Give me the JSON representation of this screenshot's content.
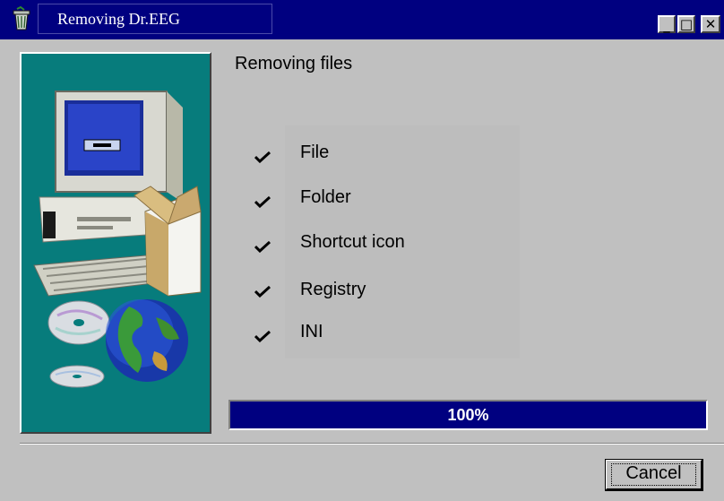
{
  "window": {
    "title": "Removing Dr.EEG",
    "icon": "recycle-bin-icon",
    "controls": {
      "minimize_icon": "minimize-icon",
      "maximize_icon": "maximize-icon",
      "close_icon": "close-icon",
      "minimize_glyph": "_",
      "maximize_glyph": "□",
      "close_glyph": "✕"
    },
    "titlebar_color": "#000080"
  },
  "main": {
    "header": "Removing files",
    "picture": "computer-box-cds-globe-illustration",
    "checklist": [
      {
        "label": "File",
        "checked": true
      },
      {
        "label": "Folder",
        "checked": true
      },
      {
        "label": "Shortcut icon",
        "checked": true
      },
      {
        "label": "Registry",
        "checked": true
      },
      {
        "label": "INI",
        "checked": true
      }
    ],
    "check_icon": "checkmark-icon"
  },
  "progress": {
    "value": 100,
    "text": "100%",
    "fill_color": "#000080"
  },
  "footer": {
    "cancel_label": "Cancel"
  }
}
